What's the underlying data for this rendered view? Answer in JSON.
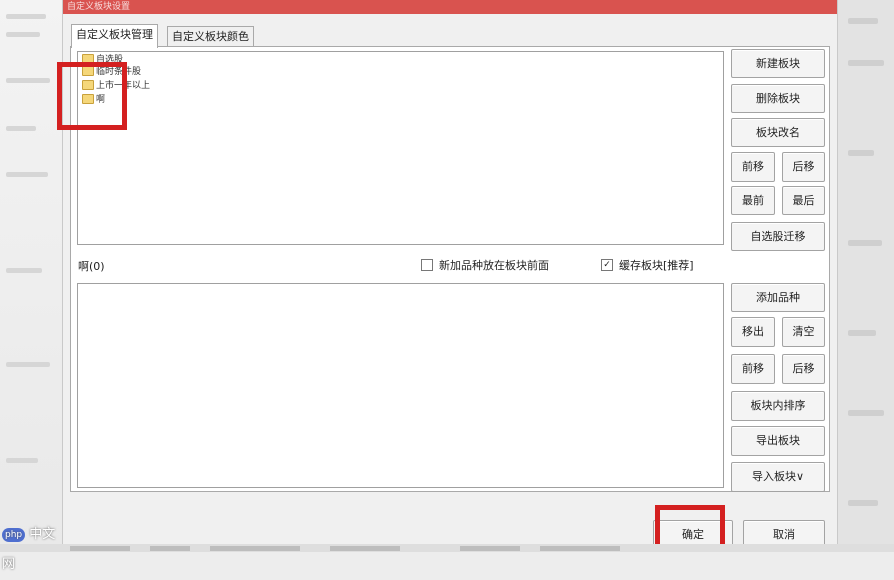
{
  "window": {
    "title": "自定义板块设置"
  },
  "tabs": [
    {
      "label": "自定义板块管理",
      "active": true
    },
    {
      "label": "自定义板块颜色",
      "active": false
    }
  ],
  "tree": {
    "items": [
      {
        "label": "自选股",
        "icon": "folder-icon"
      },
      {
        "label": "临时条件股",
        "icon": "folder-icon"
      },
      {
        "label": "上市一年以上",
        "icon": "folder-icon"
      },
      {
        "label": "啊",
        "icon": "folder-icon"
      }
    ]
  },
  "block_buttons": {
    "new": "新建板块",
    "delete": "删除板块",
    "rename": "板块改名",
    "move_forward": "前移",
    "move_back": "后移",
    "move_first": "最前",
    "move_last": "最后",
    "migrate_watchlist": "自选股迁移"
  },
  "stock_list": {
    "label": "啊(0)"
  },
  "options": {
    "add_to_front": {
      "label": "新加品种放在板块前面",
      "checked": false
    },
    "cache_block": {
      "label": "缓存板块[推荐]",
      "checked": true
    }
  },
  "stock_buttons": {
    "add": "添加品种",
    "remove": "移出",
    "clear": "清空",
    "move_forward": "前移",
    "move_back": "后移",
    "sort_in_block": "板块内排序",
    "export": "导出板块",
    "import": "导入板块∨"
  },
  "footer": {
    "ok": "确定",
    "cancel": "取消"
  },
  "watermark": {
    "badge": "php",
    "text": "中文网"
  },
  "colors": {
    "titlebar": "#d9534f",
    "annotation": "#d42020"
  }
}
